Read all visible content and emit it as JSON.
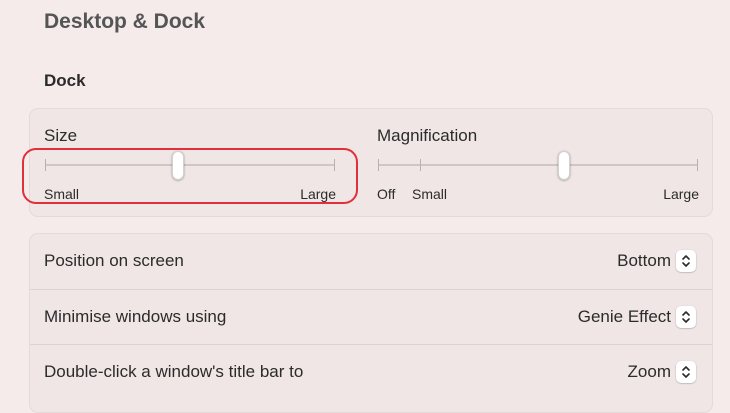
{
  "page": {
    "title": "Desktop & Dock"
  },
  "dock": {
    "title": "Dock",
    "size": {
      "label": "Size",
      "min_label": "Small",
      "max_label": "Large",
      "value": 0.46
    },
    "magnification": {
      "label": "Magnification",
      "off_label": "Off",
      "min_label": "Small",
      "max_label": "Large",
      "value": 0.58
    },
    "highlight_color": "#e0303b"
  },
  "options": [
    {
      "label": "Position on screen",
      "value": "Bottom",
      "icon": "chevron-up-down-icon"
    },
    {
      "label": "Minimise windows using",
      "value": "Genie Effect",
      "icon": "chevron-up-down-icon"
    },
    {
      "label": "Double-click a window's title bar to",
      "value": "Zoom",
      "icon": "chevron-up-down-icon"
    }
  ]
}
